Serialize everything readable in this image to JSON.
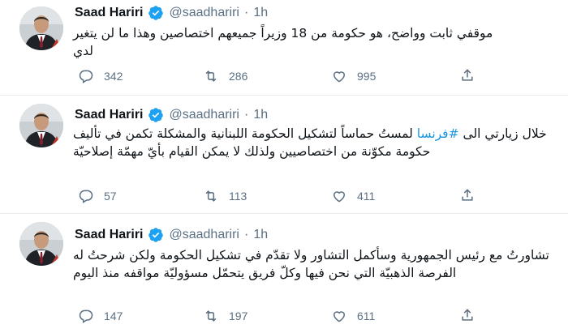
{
  "colors": {
    "link": "#1b95e0",
    "muted": "#5b7083",
    "verified": "#1da1f2",
    "divider": "#e6ecf0"
  },
  "tweets": [
    {
      "name": "Saad Hariri",
      "handle": "@saadhariri",
      "dot": "·",
      "time": "1h",
      "text_line1": "موقفي ثابت وواضح، هو حكومة  من 18 وزيراً جميعهم اختصاصين وهذا ما لن يتغير",
      "text_line2": "لدي",
      "replies": "342",
      "retweets": "286",
      "likes": "995"
    },
    {
      "name": "Saad Hariri",
      "handle": "@saadhariri",
      "dot": "·",
      "time": "1h",
      "text_pre": "خلال زيارتي الى ",
      "hashtag": "#فرنسا",
      "text_post": " لمستُ حماساً لتشكيل الحكومة اللبنانية والمشكلة تكمن في تأليف حكومة مكوّنة من اختصاصيين ولذلك لا يمكن القيام بأيّ مهمّة إصلاحيّة",
      "replies": "57",
      "retweets": "113",
      "likes": "411"
    },
    {
      "name": "Saad Hariri",
      "handle": "@saadhariri",
      "dot": "·",
      "time": "1h",
      "text": "تشاورتُ مع رئيس الجمهورية وسأكمل التشاور ولا تقدّم في تشكيل الحكومة ولكن شرحتُ له الفرصة الذهبيّة التي نحن فيها وكلّ فريق يتحمّل مسؤوليّة مواقفه منذ اليوم",
      "replies": "147",
      "retweets": "197",
      "likes": "611"
    }
  ]
}
